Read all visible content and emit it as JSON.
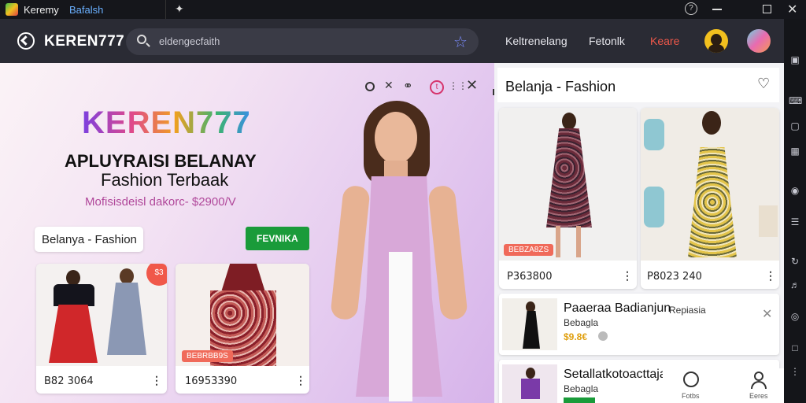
{
  "titlebar": {
    "app_name": "Keremy",
    "subtitle": "Bafalsh",
    "icons": [
      "app-logo-icon",
      "pin-icon",
      "help-circle-icon",
      "minimize-icon",
      "maximize-icon",
      "close-icon"
    ]
  },
  "appbar": {
    "brand": "KEREN777",
    "search_placeholder": "eldengecfaith",
    "nav": [
      "Keltrenelang",
      "Fetonlk",
      "Keare"
    ],
    "accent_color": "#f0584a"
  },
  "hero": {
    "brand": "KEREN777",
    "headline": "APLUYRAISI BELANAY",
    "subheadline": "Fashion Terbaak",
    "promo": "Mofisisdeisl dakorc- $2900/V",
    "tag": "Belanya - Fashion",
    "cta": "FEVNIKA",
    "products": [
      {
        "price": "B82 3064",
        "badge": "",
        "discount": "$3"
      },
      {
        "price": "16953390",
        "badge": "BEBRBB9S",
        "discount": ""
      }
    ]
  },
  "right_panel": {
    "title": "Belanja - Fashion",
    "products": [
      {
        "price": "P363800",
        "badge": "BEBZA8ZS"
      },
      {
        "price": "P8023 240",
        "badge": ""
      }
    ],
    "list": [
      {
        "title": "Paaeraa Badianjun",
        "tag": "Repiasia",
        "sub": "Bebagla",
        "price": "$9.8€"
      },
      {
        "title": "Setallatkotoacttaja",
        "tag": "",
        "sub": "Bebagla",
        "price": ""
      }
    ],
    "bottom_nav": [
      "Fotbs",
      "Eeres"
    ]
  }
}
